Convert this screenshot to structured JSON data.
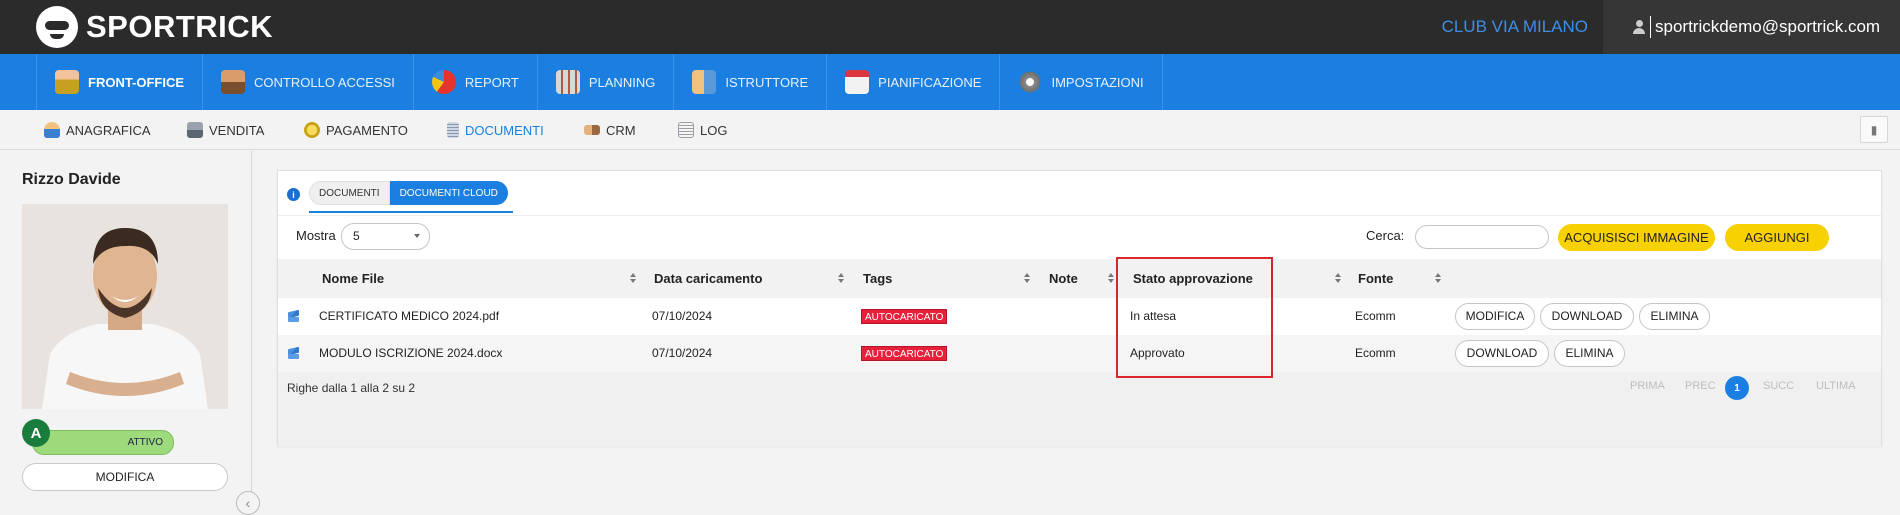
{
  "app": {
    "logo_text": "SPORTRICK"
  },
  "header": {
    "club_name": "CLUB VIA MILANO",
    "user_email": "sportrickdemo@sportrick.com"
  },
  "main_nav": {
    "items": [
      {
        "label": "FRONT-OFFICE",
        "active": true,
        "icon": "front-office-icon"
      },
      {
        "label": "CONTROLLO ACCESSI",
        "icon": "access-control-icon"
      },
      {
        "label": "REPORT",
        "icon": "report-icon"
      },
      {
        "label": "PLANNING",
        "icon": "planning-icon"
      },
      {
        "label": "ISTRUTTORE",
        "icon": "instructor-icon"
      },
      {
        "label": "PIANIFICAZIONE",
        "icon": "calendar-icon"
      },
      {
        "label": "IMPOSTAZIONI",
        "icon": "settings-icon"
      }
    ]
  },
  "sub_nav": {
    "items": [
      {
        "label": "ANAGRAFICA",
        "icon": "person-icon"
      },
      {
        "label": "VENDITA",
        "icon": "cash-register-icon"
      },
      {
        "label": "PAGAMENTO",
        "icon": "coin-icon"
      },
      {
        "label": "DOCUMENTI",
        "active": true,
        "icon": "document-icon"
      },
      {
        "label": "CRM",
        "icon": "handshake-icon"
      },
      {
        "label": "LOG",
        "icon": "log-icon"
      }
    ]
  },
  "client": {
    "name": "Rizzo Davide",
    "badge_letter": "A",
    "status": "ATTIVO",
    "edit_label": "MODIFICA"
  },
  "documents": {
    "tabs": [
      {
        "label": "DOCUMENTI"
      },
      {
        "label": "DOCUMENTI CLOUD",
        "active": true
      }
    ],
    "show_label": "Mostra",
    "page_size": "5",
    "search_label": "Cerca:",
    "search_value": "",
    "acquire_button": "ACQUISISCI IMMAGINE",
    "add_button": "AGGIUNGI",
    "columns": [
      "Nome File",
      "Data caricamento",
      "Tags",
      "Note",
      "Stato approvazione",
      "Fonte"
    ],
    "rows": [
      {
        "file": "CERTIFICATO MEDICO 2024.pdf",
        "date": "07/10/2024",
        "tag": "AUTOCARICATO",
        "note": "",
        "status": "In attesa",
        "source": "Ecomm",
        "actions": [
          "MODIFICA",
          "DOWNLOAD",
          "ELIMINA"
        ]
      },
      {
        "file": "MODULO ISCRIZIONE 2024.docx",
        "date": "07/10/2024",
        "tag": "AUTOCARICATO",
        "note": "",
        "status": "Approvato",
        "source": "Ecomm",
        "actions": [
          "DOWNLOAD",
          "ELIMINA"
        ]
      }
    ],
    "info": "Righe dalla 1 alla 2 su 2",
    "pagination": {
      "first": "PRIMA",
      "prev": "PREC",
      "current": "1",
      "next": "SUCC",
      "last": "ULTIMA"
    }
  },
  "colors": {
    "primary": "#1a7fe0",
    "topbar": "#2b2b2b",
    "accent_yellow": "#f7d101",
    "tag_red": "#e8213b",
    "status_green": "#9dda7c",
    "highlight": "#d9262c"
  }
}
